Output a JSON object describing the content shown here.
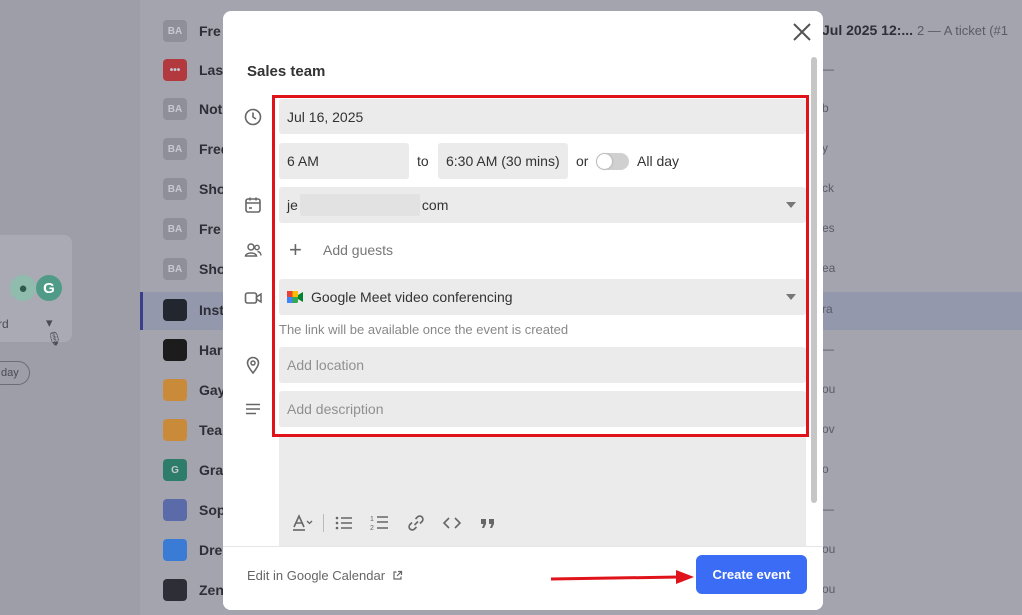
{
  "background": {
    "top_right_title": "Jul 2025 12:...",
    "top_right_suffix": "2 — A ticket (#1",
    "card_label": "rd",
    "pill_label": "day",
    "rows": [
      {
        "avatar": "BA",
        "name": "Fre",
        "right": "",
        "color": "#8e8f99"
      },
      {
        "avatar": "•••",
        "name": "Last",
        "right": "—",
        "color": "#b23a3f"
      },
      {
        "avatar": "BA",
        "name": "Not",
        "right": "b",
        "color": "#8e8f99"
      },
      {
        "avatar": "BA",
        "name": "Fred",
        "right": "y",
        "color": "#8e8f99"
      },
      {
        "avatar": "BA",
        "name": "Sho",
        "right": "ck",
        "color": "#8e8f99"
      },
      {
        "avatar": "BA",
        "name": "Fre",
        "right": "es",
        "color": "#8e8f99"
      },
      {
        "avatar": "BA",
        "name": "Sho",
        "right": "ea",
        "color": "#8e8f99"
      },
      {
        "avatar": "",
        "name": "Inst",
        "right": "ra",
        "color": "#22262f"
      },
      {
        "avatar": "",
        "name": "Har",
        "right": "—",
        "color": "#1c1c1c"
      },
      {
        "avatar": "",
        "name": "Gay",
        "right": "ou",
        "color": "#c98a3a"
      },
      {
        "avatar": "",
        "name": "Tea",
        "right": "ov",
        "color": "#c98a3a"
      },
      {
        "avatar": "G",
        "name": "Gra",
        "right": "o",
        "color": "#2e7d6a"
      },
      {
        "avatar": "",
        "name": "Sop",
        "right": "—",
        "color": "#5b6aa8"
      },
      {
        "avatar": "",
        "name": "Dre",
        "right": "ou",
        "color": "#3a7bd5"
      },
      {
        "avatar": "",
        "name": "Zen",
        "right": "ou",
        "color": "#2d2e36"
      }
    ]
  },
  "modal": {
    "title": "Sales team",
    "date": "Jul 16, 2025",
    "start_time": "6 AM",
    "to_label": "to",
    "end_time": "6:30 AM (30 mins)",
    "or_label": "or",
    "all_day_label": "All day",
    "all_day_on": false,
    "calendar_prefix": "je",
    "calendar_suffix": "com",
    "add_guests_label": "Add guests",
    "conferencing": "Google Meet video conferencing",
    "conferencing_hint": "The link will be available once the event is created",
    "location_placeholder": "Add location",
    "description_placeholder": "Add description",
    "edit_link_label": "Edit in Google Calendar",
    "create_button_label": "Create event"
  },
  "colors": {
    "primary": "#3b6cf6",
    "annotation": "#e0131a"
  }
}
